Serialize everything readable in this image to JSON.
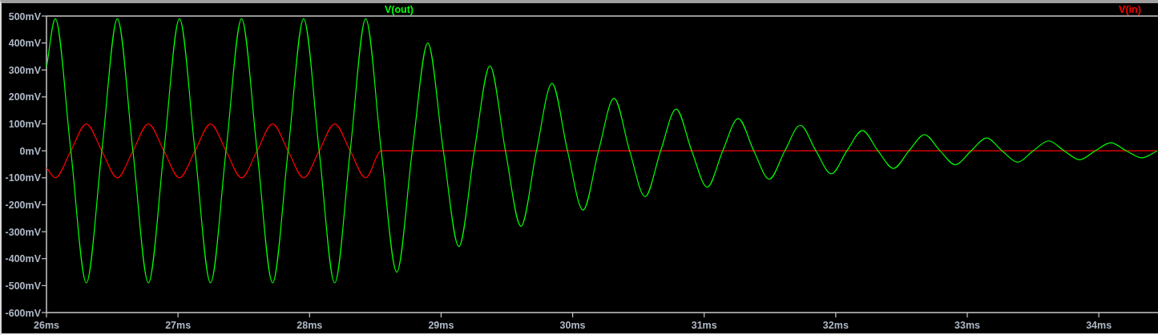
{
  "plot": {
    "chart_data": {
      "type": "line",
      "x": [
        26,
        26.067,
        26.185,
        26.303,
        26.421,
        26.539,
        26.657,
        26.775,
        26.893,
        27.011,
        27.129,
        27.247,
        27.365,
        27.483,
        27.601,
        27.719,
        27.837,
        27.955,
        28.073,
        28.191,
        28.309,
        28.427,
        28.545,
        28.663,
        28.781,
        28.899,
        29.017,
        29.135,
        29.253,
        29.371,
        29.489,
        29.607,
        29.725,
        29.843,
        29.961,
        30.079,
        30.197,
        30.315,
        30.433,
        30.551,
        30.669,
        30.787,
        30.905,
        31.023,
        31.141,
        31.259,
        31.377,
        31.495,
        31.613,
        31.731,
        31.849,
        31.967,
        32.085,
        32.203,
        32.321,
        32.439,
        32.557,
        32.675,
        32.793,
        32.911,
        33.029,
        33.147,
        33.265,
        33.383,
        33.501,
        33.619,
        33.737,
        33.855,
        33.973,
        34.091,
        34.209,
        34.327,
        34.445
      ],
      "series": [
        {
          "name": "V(out)",
          "color": "#00ff00",
          "values": [
            309,
            490,
            0,
            -490,
            0,
            490,
            0,
            -490,
            0,
            490,
            0,
            -490,
            0,
            490,
            0,
            -490,
            0,
            490,
            0,
            -490,
            0,
            490,
            0,
            -450,
            0,
            400,
            0,
            -355,
            0,
            315,
            0,
            -280,
            0,
            250,
            0,
            -220,
            0,
            195,
            0,
            -170,
            0,
            155,
            0,
            -135,
            0,
            120,
            0,
            -105,
            0,
            95,
            0,
            -85,
            0,
            75,
            0,
            -65,
            0,
            60,
            0,
            -52,
            0,
            48,
            0,
            -42,
            0,
            37,
            0,
            -33,
            0,
            30,
            0,
            -26,
            0
          ]
        },
        {
          "name": "V(in)",
          "color": "#ff0000",
          "values": [
            -63,
            -100,
            0,
            100,
            0,
            -100,
            0,
            100,
            0,
            -100,
            0,
            100,
            0,
            -100,
            0,
            100,
            0,
            -100,
            0,
            100,
            0,
            -100,
            0,
            0,
            0,
            0,
            0,
            0,
            0,
            0,
            0,
            0,
            0,
            0,
            0,
            0,
            0,
            0,
            0,
            0,
            0,
            0,
            0,
            0,
            0,
            0,
            0,
            0,
            0,
            0,
            0,
            0,
            0,
            0,
            0,
            0,
            0,
            0,
            0,
            0,
            0,
            0,
            0,
            0,
            0,
            0,
            0,
            0,
            0,
            0,
            0,
            0,
            0
          ]
        }
      ],
      "xlim": [
        26,
        34.45
      ],
      "ylim": [
        -600,
        500
      ],
      "xticks": [
        {
          "value": 26,
          "label": "26ms"
        },
        {
          "value": 27,
          "label": "27ms"
        },
        {
          "value": 28,
          "label": "28ms"
        },
        {
          "value": 29,
          "label": "29ms"
        },
        {
          "value": 30,
          "label": "30ms"
        },
        {
          "value": 31,
          "label": "31ms"
        },
        {
          "value": 32,
          "label": "32ms"
        },
        {
          "value": 33,
          "label": "33ms"
        },
        {
          "value": 34,
          "label": "34ms"
        }
      ],
      "yticks": [
        {
          "value": 500,
          "label": "500mV"
        },
        {
          "value": 400,
          "label": "400mV"
        },
        {
          "value": 300,
          "label": "300mV"
        },
        {
          "value": 200,
          "label": "200mV"
        },
        {
          "value": 100,
          "label": "100mV"
        },
        {
          "value": 0,
          "label": "0mV"
        },
        {
          "value": -100,
          "label": "-100mV"
        },
        {
          "value": -200,
          "label": "-200mV"
        },
        {
          "value": -300,
          "label": "-300mV"
        },
        {
          "value": -400,
          "label": "-400mV"
        },
        {
          "value": -500,
          "label": "-500mV"
        },
        {
          "value": -600,
          "label": "-600mV"
        }
      ]
    }
  }
}
